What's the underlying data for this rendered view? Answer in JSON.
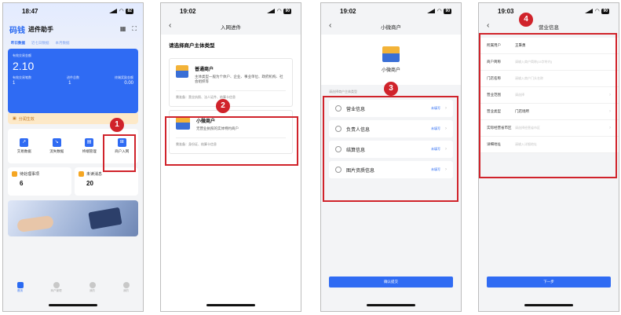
{
  "phone1": {
    "time": "18:47",
    "battery": "82",
    "logo": "码钱",
    "app_title": "进件助手",
    "tabs": [
      "昨日数据",
      "近七日数据",
      "本月数据"
    ],
    "card": {
      "total_label": "有效交易金额",
      "total_value": "2.10",
      "col_labels": [
        "有效交易笔数",
        "进件总数",
        "终端奖励金额"
      ],
      "col_values": [
        "1",
        "1",
        "0.00"
      ]
    },
    "warning": "分润生效",
    "menu": [
      "交易数据",
      "流失数据",
      "终端管理",
      "商户入网"
    ],
    "todos": [
      {
        "label": "待处理事项",
        "value": "6"
      },
      {
        "label": "未读消息",
        "value": "20"
      }
    ],
    "tabbar": [
      "首页",
      "商户管理",
      "我的",
      "我的"
    ]
  },
  "phone2": {
    "time": "19:02",
    "battery": "90",
    "nav_title": "入网进件",
    "section_title": "请选择商户主体类型",
    "cards": [
      {
        "title": "普通商户",
        "desc": "主体类型一般为个体户、企业、事业单位、政府机构、社会组织等",
        "prep": "需准备：营业执照、法人证件、结算卡信息"
      },
      {
        "title": "小微商户",
        "desc": "无营业执照的实体特约商户",
        "prep": "需准备：身份证、结算卡信息"
      }
    ]
  },
  "phone3": {
    "time": "19:02",
    "battery": "90",
    "nav_title": "小微商户",
    "hero_label": "小微商户",
    "sub_label": "请选择商户主体类型",
    "rows": [
      {
        "label": "营业信息",
        "status": "未填写"
      },
      {
        "label": "负责人信息",
        "status": "未填写"
      },
      {
        "label": "结算信息",
        "status": "未填写"
      },
      {
        "label": "图片资质信息",
        "status": "未填写"
      }
    ],
    "submit": "确认提交"
  },
  "phone4": {
    "time": "19:03",
    "battery": "90",
    "nav_title": "营业信息",
    "fields": [
      {
        "label": "所属用户",
        "value": "王秉勇",
        "placeholder": ""
      },
      {
        "label": "商户简称",
        "value": "",
        "placeholder": "请输入商户简称(15字符内)"
      },
      {
        "label": "门店名称",
        "value": "",
        "placeholder": "请输入商户门头名称"
      },
      {
        "label": "营业范围",
        "value": "",
        "placeholder": "请选择"
      },
      {
        "label": "营业类型",
        "value": "门店场所",
        "placeholder": ""
      },
      {
        "label": "实际经营省市区",
        "value": "",
        "placeholder": "请选择经营省市区"
      },
      {
        "label": "详细地址",
        "value": "",
        "placeholder": "请输入详细地址"
      }
    ],
    "next": "下一步"
  },
  "callouts": [
    "1",
    "2",
    "3",
    "4"
  ],
  "colors": {
    "accent": "#2f6bf3",
    "callout": "#d0232b",
    "warning_bg": "#fde9c8"
  }
}
